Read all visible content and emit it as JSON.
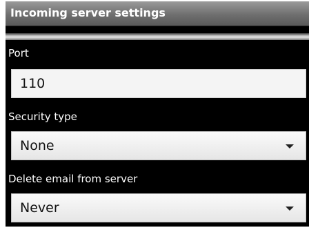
{
  "header": {
    "title": "Incoming server settings"
  },
  "form": {
    "port": {
      "label": "Port",
      "value": "110"
    },
    "security_type": {
      "label": "Security type",
      "selected": "None",
      "icon": "dropdown-triangle-icon"
    },
    "delete_email": {
      "label": "Delete email from server",
      "selected": "Never",
      "icon": "dropdown-triangle-icon"
    }
  }
}
